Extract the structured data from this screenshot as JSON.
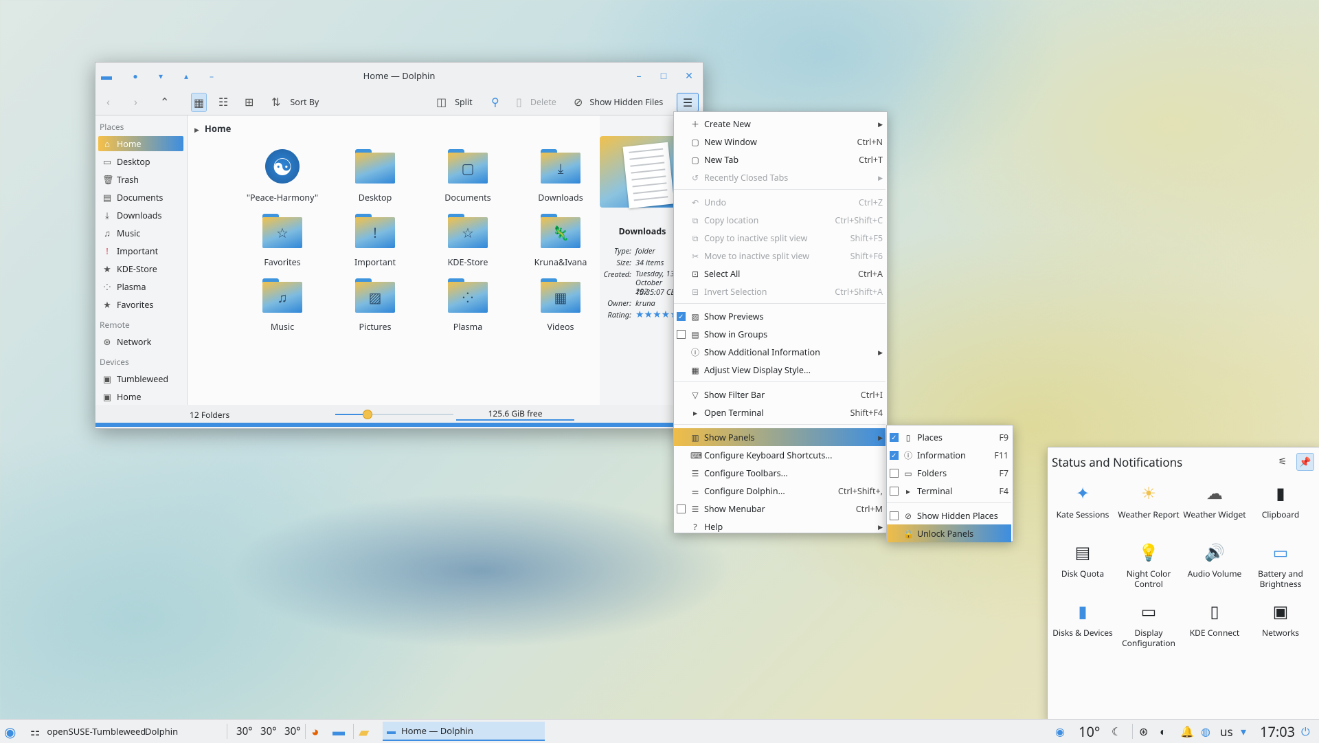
{
  "window": {
    "title": "Home — Dolphin",
    "toolbar": {
      "sort": "Sort By",
      "split": "Split",
      "delete": "Delete",
      "hidden": "Show Hidden Files"
    }
  },
  "sidebar": {
    "places_header": "Places",
    "places": [
      {
        "label": "Home",
        "icon": "home-icon",
        "glyph": "⌂"
      },
      {
        "label": "Desktop",
        "icon": "desktop-icon",
        "glyph": "▭"
      },
      {
        "label": "Trash",
        "icon": "trash-icon",
        "glyph": "🗑"
      },
      {
        "label": "Documents",
        "icon": "documents-icon",
        "glyph": "▤"
      },
      {
        "label": "Downloads",
        "icon": "downloads-icon",
        "glyph": "⤓"
      },
      {
        "label": "Music",
        "icon": "music-icon",
        "glyph": "♫"
      },
      {
        "label": "Important",
        "icon": "important-icon",
        "glyph": "!"
      },
      {
        "label": "KDE-Store",
        "icon": "star-icon",
        "glyph": "★"
      },
      {
        "label": "Plasma",
        "icon": "plasma-icon",
        "glyph": "⁘"
      },
      {
        "label": "Favorites",
        "icon": "star-icon",
        "glyph": "★"
      }
    ],
    "remote_header": "Remote",
    "remote": [
      {
        "label": "Network",
        "icon": "network-icon",
        "glyph": "⊛"
      }
    ],
    "devices_header": "Devices",
    "devices": [
      {
        "label": "Tumbleweed",
        "icon": "drive-icon",
        "glyph": "▣"
      },
      {
        "label": "Home",
        "icon": "drive-icon",
        "glyph": "▣"
      }
    ]
  },
  "breadcrumb": "Home",
  "files": [
    {
      "name": "\"Peace-Harmony\"",
      "icon": "yin-yang-icon",
      "glyph": "☯"
    },
    {
      "name": "Desktop",
      "icon": "desktop-folder-icon",
      "glyph": ""
    },
    {
      "name": "Documents",
      "icon": "documents-folder-icon",
      "glyph": "▢"
    },
    {
      "name": "Downloads",
      "icon": "downloads-folder-icon",
      "glyph": "⤓"
    },
    {
      "name": "Favorites",
      "icon": "favorites-folder-icon",
      "glyph": "☆"
    },
    {
      "name": "Important",
      "icon": "important-folder-icon",
      "glyph": "!"
    },
    {
      "name": "KDE-Store",
      "icon": "kde-store-folder-icon",
      "glyph": "☆"
    },
    {
      "name": "Kruna&Ivana",
      "icon": "chameleon-folder-icon",
      "glyph": "🦎"
    },
    {
      "name": "Music",
      "icon": "music-folder-icon",
      "glyph": "♫"
    },
    {
      "name": "Pictures",
      "icon": "pictures-folder-icon",
      "glyph": "▨"
    },
    {
      "name": "Plasma",
      "icon": "plasma-folder-icon",
      "glyph": "⁘"
    },
    {
      "name": "Videos",
      "icon": "videos-folder-icon",
      "glyph": "▦"
    }
  ],
  "info": {
    "title": "Downloads",
    "type_key": "Type:",
    "type": "folder",
    "size_key": "Size:",
    "size": "34 items",
    "created_key": "Created:",
    "created": "Tuesday, 13 October 202",
    "created_time": "15:35:07 CES",
    "owner_key": "Owner:",
    "owner": "kruna",
    "rating_key": "Rating:",
    "rating": "★★★★★"
  },
  "status": {
    "folders": "12 Folders",
    "free": "125.6 GiB free"
  },
  "menu": [
    {
      "label": "Create New",
      "icon": "create-new-icon",
      "glyph": "＋",
      "sub": true
    },
    {
      "label": "New Window",
      "icon": "new-window-icon",
      "glyph": "▢",
      "sc": "Ctrl+N"
    },
    {
      "label": "New Tab",
      "icon": "new-tab-icon",
      "glyph": "▢",
      "sc": "Ctrl+T"
    },
    {
      "label": "Recently Closed Tabs",
      "icon": "recent-tabs-icon",
      "glyph": "↺",
      "dis": true,
      "sub": true
    },
    {
      "sep": true
    },
    {
      "label": "Undo",
      "icon": "undo-icon",
      "glyph": "↶",
      "sc": "Ctrl+Z",
      "dis": true
    },
    {
      "label": "Copy location",
      "icon": "copy-icon",
      "glyph": "⧉",
      "sc": "Ctrl+Shift+C",
      "dis": true
    },
    {
      "label": "Copy to inactive split view",
      "icon": "copy-split-icon",
      "glyph": "⧉",
      "sc": "Shift+F5",
      "dis": true
    },
    {
      "label": "Move to inactive split view",
      "icon": "move-split-icon",
      "glyph": "✂",
      "sc": "Shift+F6",
      "dis": true
    },
    {
      "label": "Select All",
      "icon": "select-all-icon",
      "glyph": "⊡",
      "sc": "Ctrl+A"
    },
    {
      "label": "Invert Selection",
      "icon": "invert-icon",
      "glyph": "⊟",
      "sc": "Ctrl+Shift+A",
      "dis": true
    },
    {
      "sep": true
    },
    {
      "label": "Show Previews",
      "icon": "previews-icon",
      "glyph": "▨",
      "chk": true,
      "on": true
    },
    {
      "label": "Show in Groups",
      "icon": "groups-icon",
      "glyph": "▤",
      "chk": true,
      "on": false
    },
    {
      "label": "Show Additional Information",
      "icon": "info-icon",
      "glyph": "ⓘ",
      "sub": true
    },
    {
      "label": "Adjust View Display Style...",
      "icon": "view-style-icon",
      "glyph": "▦"
    },
    {
      "sep": true
    },
    {
      "label": "Show Filter Bar",
      "icon": "filter-icon",
      "glyph": "▽",
      "sc": "Ctrl+I"
    },
    {
      "label": "Open Terminal",
      "icon": "terminal-icon",
      "glyph": "▸",
      "sc": "Shift+F4"
    },
    {
      "sep": true
    },
    {
      "label": "Show Panels",
      "icon": "panels-icon",
      "glyph": "▥",
      "sub": true,
      "hl": true
    },
    {
      "label": "Configure Keyboard Shortcuts...",
      "icon": "keyboard-icon",
      "glyph": "⌨"
    },
    {
      "label": "Configure Toolbars...",
      "icon": "toolbars-icon",
      "glyph": "☰"
    },
    {
      "label": "Configure Dolphin...",
      "icon": "configure-icon",
      "glyph": "⚌",
      "sc": "Ctrl+Shift+,"
    },
    {
      "label": "Show Menubar",
      "icon": "menubar-icon",
      "glyph": "☰",
      "sc": "Ctrl+M",
      "chk": true,
      "on": false
    },
    {
      "label": "Help",
      "icon": "help-icon",
      "glyph": "?",
      "sub": true
    }
  ],
  "submenu": [
    {
      "label": "Places",
      "icon": "places-icon",
      "glyph": "▯",
      "sc": "F9",
      "chk": true,
      "on": true
    },
    {
      "label": "Information",
      "icon": "information-icon",
      "glyph": "ⓘ",
      "sc": "F11",
      "chk": true,
      "on": true
    },
    {
      "label": "Folders",
      "icon": "folders-icon",
      "glyph": "▭",
      "sc": "F7",
      "chk": true,
      "on": false
    },
    {
      "label": "Terminal",
      "icon": "terminal-icon",
      "glyph": "▸",
      "sc": "F4",
      "chk": true,
      "on": false
    },
    {
      "sep": true
    },
    {
      "label": "Show Hidden Places",
      "icon": "hidden-places-icon",
      "glyph": "⊘",
      "chk": true,
      "on": false
    },
    {
      "label": "Unlock Panels",
      "icon": "lock-icon",
      "glyph": "🔒",
      "hl": true
    }
  ],
  "notifications": {
    "title": "Status and Notifications",
    "items": [
      {
        "label": "Kate Sessions",
        "icon": "kate-icon",
        "glyph": "✦",
        "color": "#3d8ee0"
      },
      {
        "label": "Weather Report",
        "icon": "sun-icon",
        "glyph": "☀",
        "color": "#f2c14b"
      },
      {
        "label": "Weather Widget",
        "icon": "cloud-icon",
        "glyph": "☁",
        "color": "#555555"
      },
      {
        "label": "Clipboard",
        "icon": "clipboard-icon",
        "glyph": "▮",
        "color": "#232629"
      },
      {
        "label": "Disk Quota",
        "icon": "disk-quota-icon",
        "glyph": "▤",
        "color": "#232629"
      },
      {
        "label": "Night Color Control",
        "icon": "bulb-icon",
        "glyph": "💡",
        "color": "#232629"
      },
      {
        "label": "Audio Volume",
        "icon": "speaker-icon",
        "glyph": "🔊",
        "color": "#232629"
      },
      {
        "label": "Battery and Brightness",
        "icon": "battery-icon",
        "glyph": "▭",
        "color": "#3d8ee0"
      },
      {
        "label": "Disks & Devices",
        "icon": "usb-icon",
        "glyph": "▮",
        "color": "#3d8ee0"
      },
      {
        "label": "Display Configuration",
        "icon": "display-icon",
        "glyph": "▭",
        "color": "#232629"
      },
      {
        "label": "KDE Connect",
        "icon": "phone-icon",
        "glyph": "▯",
        "color": "#232629"
      },
      {
        "label": "Networks",
        "icon": "networks-icon",
        "glyph": "▣",
        "color": "#232629"
      }
    ]
  },
  "taskbar": {
    "activity": "openSUSE-Tumbleweed",
    "app": "Dolphin",
    "temps": [
      "30°",
      "30°",
      "30°"
    ],
    "task": "Home — Dolphin",
    "weather": "10°",
    "layout": "us",
    "clock": "17:03"
  }
}
